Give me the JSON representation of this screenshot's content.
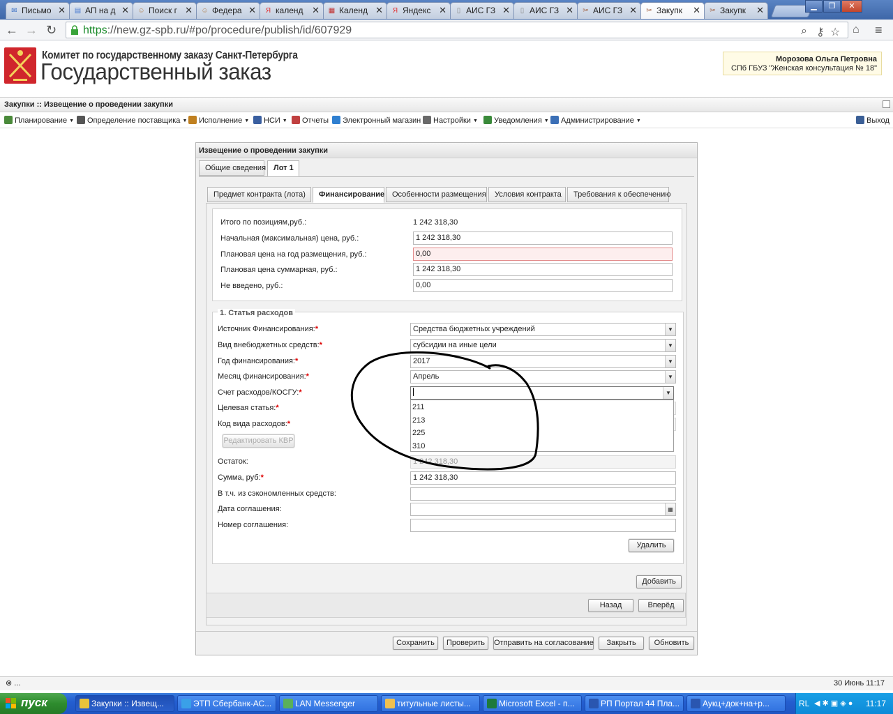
{
  "browser": {
    "tabs": [
      {
        "title": "Письмо",
        "icon": "mail-icon"
      },
      {
        "title": "АП на д",
        "icon": "doc-icon"
      },
      {
        "title": "Поиск г",
        "icon": "person-icon"
      },
      {
        "title": "Федера",
        "icon": "person-icon"
      },
      {
        "title": "календ",
        "icon": "yandex-icon"
      },
      {
        "title": "Календ",
        "icon": "calendar-icon"
      },
      {
        "title": "Яндекс",
        "icon": "yandex-icon"
      },
      {
        "title": "АИС ГЗ",
        "icon": "page-icon"
      },
      {
        "title": "АИС ГЗ",
        "icon": "page-icon"
      },
      {
        "title": "АИС ГЗ",
        "icon": "tools-icon"
      },
      {
        "title": "Закупк",
        "icon": "tools-icon",
        "active": true
      },
      {
        "title": "Закупк",
        "icon": "tools-icon"
      }
    ],
    "url_scheme": "https",
    "url_rest": "://new.gz-spb.ru/#po/procedure/publish/id/607929"
  },
  "site": {
    "org_line": "Комитет по государственному заказу Санкт-Петербурга",
    "title": "Государственный заказ",
    "user_name": "Морозова Ольга Петровна",
    "user_org": "СПб ГБУЗ \"Женская консультация № 18\""
  },
  "breadcrumb": "Закупки :: Извещение о проведении закупки",
  "menu": [
    {
      "label": "Планирование",
      "icon": "planning-icon",
      "dd": true
    },
    {
      "label": "Определение поставщика",
      "icon": "gear-icon",
      "dd": true
    },
    {
      "label": "Исполнение",
      "icon": "box-icon",
      "dd": true
    },
    {
      "label": "НСИ",
      "icon": "book-icon",
      "dd": true
    },
    {
      "label": "Отчеты",
      "icon": "report-icon",
      "dd": false
    },
    {
      "label": "Электронный магазин",
      "icon": "cart-icon",
      "dd": false
    },
    {
      "label": "Настройки",
      "icon": "wrench-icon",
      "dd": true
    },
    {
      "label": "Уведомления",
      "icon": "bell-icon",
      "dd": true
    },
    {
      "label": "Администрирование",
      "icon": "admin-icon",
      "dd": true
    }
  ],
  "logout": "Выход",
  "window": {
    "title": "Извещение о проведении закупки",
    "top_tabs": [
      "Общие сведения",
      "Лот 1"
    ],
    "sub_tabs": [
      "Предмет контракта (лота)",
      "Финансирование",
      "Особенности размещения",
      "Условия контракта",
      "Требования к обеспечению"
    ]
  },
  "summary": {
    "total_label": "Итого по позициям,руб.:",
    "total_value": "1 242 318,30",
    "nmc_label": "Начальная (максимальная) цена, руб.:",
    "nmc_value": "1 242 318,30",
    "plan_year_label": "Плановая цена на год размещения, руб.:",
    "plan_year_value": "0,00",
    "plan_total_label": "Плановая цена суммарная, руб.:",
    "plan_total_value": "1 242 318,30",
    "not_entered_label": "Не введено, руб.:",
    "not_entered_value": "0,00"
  },
  "expense": {
    "legend": "1. Статья расходов",
    "source_label": "Источник Финансирования:",
    "source_value": "Средства бюджетных учреждений",
    "kind_label": "Вид внебюджетных средств:",
    "kind_value": "субсидии на иные цели",
    "year_label": "Год финансирования:",
    "year_value": "2017",
    "month_label": "Месяц финансирования:",
    "month_value": "Апрель",
    "account_label": "Счет расходов/КОСГУ:",
    "account_value": "",
    "target_label": "Целевая статья:",
    "kvr_label": "Код вида расходов:",
    "edit_kvr": "Редактировать КВР",
    "rest_label": "Остаток:",
    "rest_value": "1 242 318,30",
    "sum_label": "Сумма, руб:",
    "sum_value": "1 242 318,30",
    "saved_label": "В т.ч. из сэкономленных средств:",
    "date_label": "Дата соглашения:",
    "number_label": "Номер соглашения:",
    "delete": "Удалить",
    "options": [
      "211",
      "213",
      "225",
      "310"
    ]
  },
  "buttons": {
    "add": "Добавить",
    "back": "Назад",
    "forward": "Вперёд",
    "save": "Сохранить",
    "check": "Проверить",
    "send": "Отправить на согласование",
    "close": "Закрыть",
    "refresh": "Обновить"
  },
  "status": {
    "left": "...",
    "right": "30 Июнь 11:17"
  },
  "taskbar": {
    "start": "пуск",
    "tasks": [
      {
        "label": "Закупки :: Извещ...",
        "icon": "chrome-icon",
        "active": true
      },
      {
        "label": "ЭТП Сбербанк-АС...",
        "icon": "ie-icon"
      },
      {
        "label": "LAN Messenger",
        "icon": "messenger-icon"
      },
      {
        "label": "титульные листы...",
        "icon": "folder-icon"
      },
      {
        "label": "Microsoft Excel - п...",
        "icon": "excel-icon"
      },
      {
        "label": "РП Портал 44 Пла...",
        "icon": "word-icon"
      },
      {
        "label": "Аукц+док+на+р...",
        "icon": "word-icon"
      }
    ],
    "lang": "RL",
    "clock": "11:17"
  },
  "colors": {
    "accent": "#d0262c",
    "required": "#dd0000",
    "error_bg": "#fdeeee"
  }
}
